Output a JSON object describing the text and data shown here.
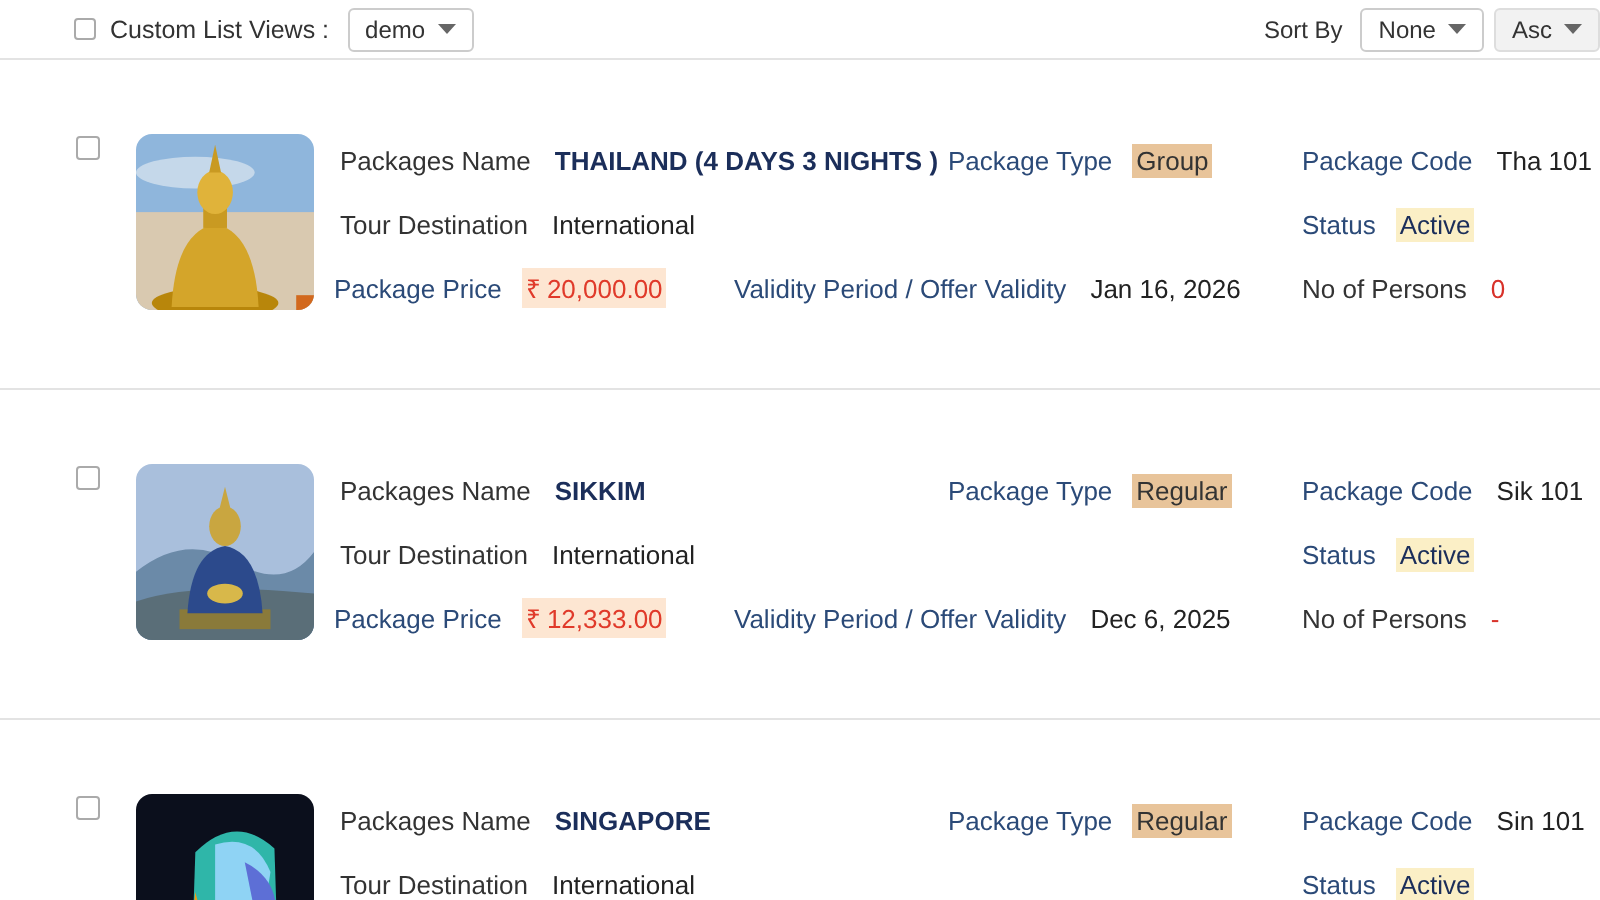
{
  "toolbar": {
    "select_all": {
      "checked": false
    },
    "list_views_label": "Custom List Views :",
    "list_view": "demo",
    "sort_label": "Sort By",
    "sort_field": "None",
    "sort_order": "Asc"
  },
  "packages": [
    {
      "checked": false,
      "fields": [
        {
          "label": "Packages Name",
          "value": "THAILAND (4 DAYS 3 NIGHTS )",
          "kind": "title"
        },
        {
          "label": "Package Type",
          "value": "Group",
          "kind": "tag"
        },
        {
          "label": "Package Code",
          "value": "Tha 101",
          "kind": "text"
        },
        {
          "label": "Tour Destination",
          "value": "International",
          "kind": "plain"
        },
        {
          "label": "Status",
          "value": "Active",
          "kind": "status"
        },
        {
          "label": "Package Price",
          "value": "₹ 20,000.00",
          "kind": "price"
        },
        {
          "label": "Validity Period / Offer Validity",
          "value": "Jan 16, 2026",
          "kind": "text"
        },
        {
          "label": "No of Persons",
          "value": "0",
          "kind": "alert"
        }
      ]
    },
    {
      "checked": false,
      "fields": [
        {
          "label": "Packages Name",
          "value": "SIKKIM",
          "kind": "title"
        },
        {
          "label": "Package Type",
          "value": "Regular",
          "kind": "tag"
        },
        {
          "label": "Package Code",
          "value": "Sik 101",
          "kind": "text"
        },
        {
          "label": "Tour Destination",
          "value": "International",
          "kind": "plain"
        },
        {
          "label": "Status",
          "value": "Active",
          "kind": "status"
        },
        {
          "label": "Package Price",
          "value": "₹ 12,333.00",
          "kind": "price"
        },
        {
          "label": "Validity Period / Offer Validity",
          "value": "Dec 6, 2025",
          "kind": "text"
        },
        {
          "label": "No of Persons",
          "value": "-",
          "kind": "alert"
        }
      ]
    },
    {
      "checked": false,
      "fields": [
        {
          "label": "Packages Name",
          "value": "SINGAPORE",
          "kind": "title"
        },
        {
          "label": "Package Type",
          "value": "Regular",
          "kind": "tag"
        },
        {
          "label": "Package Code",
          "value": "Sin 101",
          "kind": "text"
        },
        {
          "label": "Tour Destination",
          "value": "International",
          "kind": "plain"
        },
        {
          "label": "Status",
          "value": "Active",
          "kind": "status"
        }
      ]
    }
  ]
}
